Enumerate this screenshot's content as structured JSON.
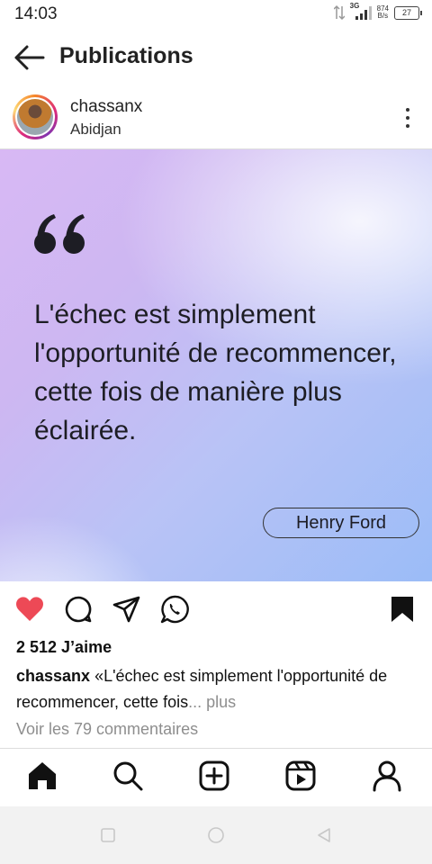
{
  "status_bar": {
    "time": "14:03",
    "network": "3G",
    "speed": "874",
    "speed_unit": "B/s",
    "battery": "27"
  },
  "header": {
    "title": "Publications"
  },
  "post": {
    "username": "chassanx",
    "location": "Abidjan",
    "image": {
      "quote_mark": "“",
      "quote_text": "L'échec est simplement l'opportunité de recommencer, cette fois de manière plus éclairée.",
      "author": "Henry Ford"
    },
    "likes": "2 512 J’aime",
    "caption_username": "chassanx",
    "caption_text": "«L'échec est simplement l'opportunité de recommencer, cette fois",
    "caption_more": "... plus",
    "comments_link": "Voir les 79 commentaires",
    "liked": true,
    "saved": true
  },
  "colors": {
    "like": "#ed4956",
    "text": "#111111",
    "muted": "#8e8e8e"
  },
  "icons": {
    "actions": [
      "heart-icon",
      "comment-icon",
      "share-icon",
      "whatsapp-icon",
      "bookmark-icon"
    ],
    "tabs": [
      "home-icon",
      "search-icon",
      "create-icon",
      "reels-icon",
      "profile-icon"
    ],
    "system_nav": [
      "recents-icon",
      "home-circle-icon",
      "back-triangle-icon"
    ]
  }
}
